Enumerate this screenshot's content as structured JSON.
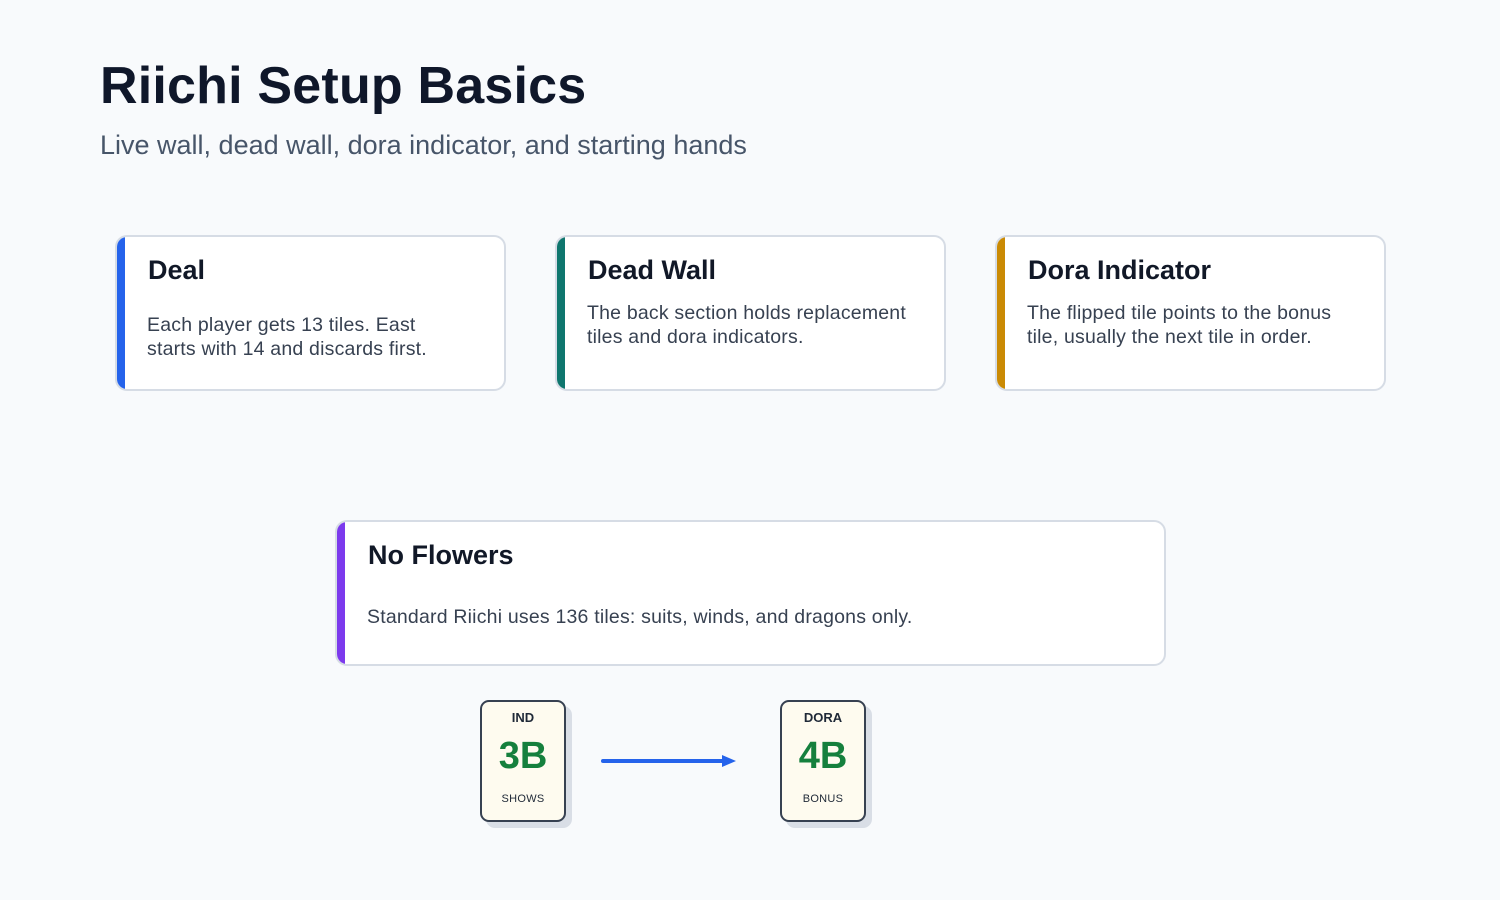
{
  "header": {
    "title": "Riichi Setup Basics",
    "subtitle": "Live wall, dead wall, dora indicator, and starting hands"
  },
  "cards": [
    {
      "id": "deal",
      "title": "Deal",
      "body": "Each player gets 13 tiles. East starts with 14 and discards first.",
      "accent": "#2563eb"
    },
    {
      "id": "dead-wall",
      "title": "Dead Wall",
      "body": "The back section holds replacement tiles and dora indicators.",
      "accent": "#0f766e"
    },
    {
      "id": "dora-indicator",
      "title": "Dora Indicator",
      "body": "The flipped tile points to the bonus tile, usually the next tile in order.",
      "accent": "#ca8a04"
    },
    {
      "id": "no-flowers",
      "title": "No Flowers",
      "body": "Standard Riichi uses 136 tiles: suits, winds, and dragons only.",
      "accent": "#7c3aed"
    }
  ],
  "tiles": {
    "indicator": {
      "top": "IND",
      "face": "3B",
      "bottom": "SHOWS"
    },
    "dora": {
      "top": "DORA",
      "face": "4B",
      "bottom": "BONUS"
    }
  },
  "colors": {
    "arrow": "#2563eb",
    "tile_face": "#15803d"
  }
}
